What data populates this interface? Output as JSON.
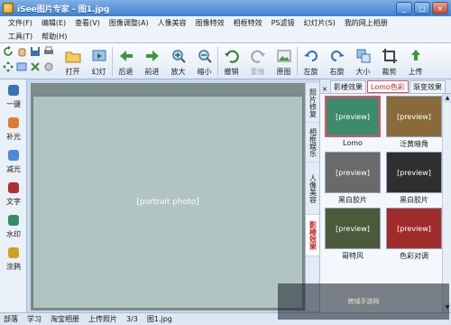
{
  "window": {
    "title": "iSee图片专家 - 图1.jpg",
    "min": "_",
    "max": "□",
    "close": "×"
  },
  "menu": {
    "row1": [
      "文件(F)",
      "编辑(E)",
      "查看(V)",
      "图像调整(A)",
      "人像美容",
      "图像特效",
      "相框特效",
      "PS滤镜",
      "幻灯片(S)",
      "我的网上相册"
    ],
    "row2": [
      "工具(T)",
      "帮助(H)"
    ]
  },
  "toolbar": [
    {
      "label": "打开",
      "icon": "folder-open-icon",
      "enabled": true
    },
    {
      "label": "幻灯",
      "icon": "slideshow-icon",
      "enabled": true
    },
    {
      "label": "后退",
      "icon": "back-arrow-icon",
      "enabled": true
    },
    {
      "label": "前进",
      "icon": "forward-arrow-icon",
      "enabled": true
    },
    {
      "label": "放大",
      "icon": "zoom-in-icon",
      "enabled": true
    },
    {
      "label": "缩小",
      "icon": "zoom-out-icon",
      "enabled": true
    },
    {
      "label": "撤销",
      "icon": "undo-icon",
      "enabled": true
    },
    {
      "label": "重做",
      "icon": "redo-icon",
      "enabled": false
    },
    {
      "label": "原图",
      "icon": "original-image-icon",
      "enabled": true
    },
    {
      "label": "左旋",
      "icon": "rotate-left-icon",
      "enabled": true
    },
    {
      "label": "右旋",
      "icon": "rotate-right-icon",
      "enabled": true
    },
    {
      "label": "大小",
      "icon": "resize-icon",
      "enabled": true
    },
    {
      "label": "裁剪",
      "icon": "crop-icon",
      "enabled": true
    },
    {
      "label": "上传",
      "icon": "upload-icon",
      "enabled": true
    }
  ],
  "left_tools": [
    {
      "label": "一键",
      "icon": "one-click-icon"
    },
    {
      "label": "补光",
      "icon": "fill-light-icon"
    },
    {
      "label": "减光",
      "icon": "reduce-light-icon"
    },
    {
      "label": "文字",
      "icon": "text-icon"
    },
    {
      "label": "水印",
      "icon": "watermark-icon"
    },
    {
      "label": "涂鸦",
      "icon": "doodle-icon"
    }
  ],
  "vertical_tabs": [
    {
      "label": "照片修复",
      "active": false
    },
    {
      "label": "相框娱乐",
      "active": false
    },
    {
      "label": "人像美容",
      "active": false
    },
    {
      "label": "影楼效果",
      "active": true
    }
  ],
  "effects": {
    "close": "×",
    "tabs": [
      {
        "label": "影楼效果",
        "active": false
      },
      {
        "label": "Lomo色彩",
        "active": true
      },
      {
        "label": "渐变效果",
        "active": false
      }
    ],
    "items": [
      {
        "label": "Lomo",
        "selected": true,
        "tint": "#3e8a6d"
      },
      {
        "label": "泛黄暗角",
        "selected": false,
        "tint": "#8a6a3a"
      },
      {
        "label": "黑白胶片",
        "selected": false,
        "tint": "#6a6a6a"
      },
      {
        "label": "黑白胶片",
        "selected": false,
        "tint": "#2f2f2f"
      },
      {
        "label": "哥特风",
        "selected": false,
        "tint": "#4a5a3a"
      },
      {
        "label": "色彩对调",
        "selected": false,
        "tint": "#a02b2b"
      }
    ]
  },
  "status": {
    "items": [
      "部落",
      "学习",
      "淘宝相册",
      "上传照片",
      "3/3",
      "图1.jpg"
    ]
  },
  "watermark": {
    "text": "跨域手游网"
  },
  "colors": {
    "accent": "#e05064",
    "titlebar": "#3f7fd0"
  }
}
